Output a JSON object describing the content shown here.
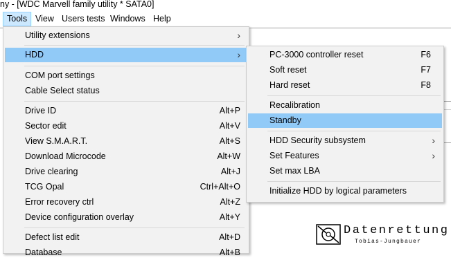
{
  "window": {
    "title": "ny - [WDC Marvell family utility * SATA0]"
  },
  "menubar": {
    "items": [
      {
        "label": "Tools"
      },
      {
        "label": "View"
      },
      {
        "label": "Users tests"
      },
      {
        "label": "Windows"
      },
      {
        "label": "Help"
      }
    ]
  },
  "tools_menu": {
    "items": [
      {
        "label": "Utility extensions",
        "shortcut": ""
      },
      {
        "label": "HDD",
        "shortcut": ""
      },
      {
        "label": "COM port settings",
        "shortcut": ""
      },
      {
        "label": "Cable Select status",
        "shortcut": ""
      },
      {
        "label": "Drive ID",
        "shortcut": "Alt+P"
      },
      {
        "label": "Sector edit",
        "shortcut": "Alt+V"
      },
      {
        "label": "View S.M.A.R.T.",
        "shortcut": "Alt+S"
      },
      {
        "label": "Download Microcode",
        "shortcut": "Alt+W"
      },
      {
        "label": "Drive clearing",
        "shortcut": "Alt+J"
      },
      {
        "label": "TCG Opal",
        "shortcut": "Ctrl+Alt+O"
      },
      {
        "label": "Error recovery ctrl",
        "shortcut": "Alt+Z"
      },
      {
        "label": "Device configuration overlay",
        "shortcut": "Alt+Y"
      },
      {
        "label": "Defect list edit",
        "shortcut": "Alt+D"
      },
      {
        "label": "Database",
        "shortcut": "Alt+B"
      }
    ]
  },
  "hdd_menu": {
    "items": [
      {
        "label": "PC-3000 controller reset",
        "shortcut": "F6"
      },
      {
        "label": "Soft reset",
        "shortcut": "F7"
      },
      {
        "label": "Hard reset",
        "shortcut": "F8"
      },
      {
        "label": "Recalibration",
        "shortcut": ""
      },
      {
        "label": "Standby",
        "shortcut": ""
      },
      {
        "label": "HDD Security subsystem",
        "shortcut": ""
      },
      {
        "label": "Set Features",
        "shortcut": ""
      },
      {
        "label": "Set max LBA",
        "shortcut": ""
      },
      {
        "label": "Initialize HDD by logical parameters",
        "shortcut": ""
      }
    ]
  },
  "submenu_arrow": "›",
  "logo": {
    "word": "Datenrettung",
    "sub": "Tobias-Jungbauer",
    "icon": "disk-pen-logo-icon"
  }
}
